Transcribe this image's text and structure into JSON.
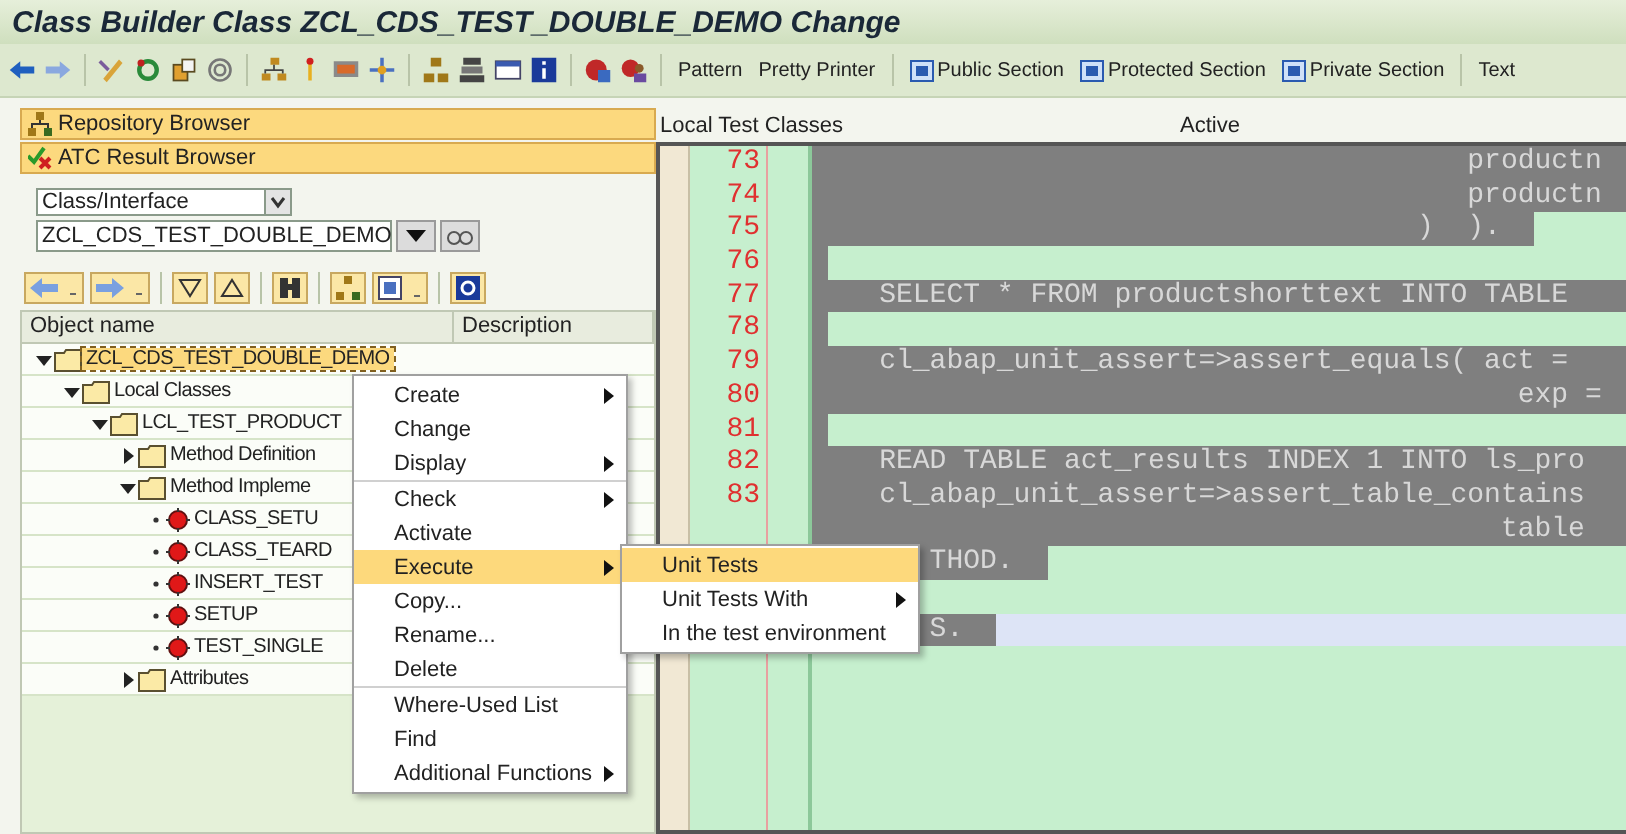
{
  "window": {
    "title": "Class Builder Class ZCL_CDS_TEST_DOUBLE_DEMO Change"
  },
  "toolbar": {
    "buttons": [
      {
        "label": "Pattern",
        "kind": "text"
      },
      {
        "label": "Pretty Printer",
        "kind": "text"
      },
      {
        "label": "Public Section",
        "kind": "section"
      },
      {
        "label": "Protected Section",
        "kind": "section"
      },
      {
        "label": "Private Section",
        "kind": "section"
      },
      {
        "label": "Text",
        "kind": "text"
      }
    ]
  },
  "navigator": {
    "buttons": [
      "Repository Browser",
      "ATC Result Browser"
    ],
    "object_type": "Class/Interface",
    "object_name": "ZCL_CDS_TEST_DOUBLE_DEMO",
    "columns": [
      "Object name",
      "Description"
    ],
    "tree": [
      {
        "label": "ZCL_CDS_TEST_DOUBLE_DEMO",
        "kind": "folder",
        "expanded": true,
        "selected": true,
        "children": [
          {
            "label": "Local Classes",
            "kind": "folder",
            "expanded": true,
            "selected": false,
            "children": [
              {
                "label": "LCL_TEST_PRODUCT",
                "kind": "folder",
                "expanded": true,
                "selected": false,
                "children": [
                  {
                    "label": "Method Definition",
                    "kind": "folder",
                    "expanded": false,
                    "selected": false
                  },
                  {
                    "label": "Method Impleme",
                    "kind": "folder",
                    "expanded": true,
                    "selected": false,
                    "children": [
                      {
                        "label": "CLASS_SETU",
                        "kind": "method",
                        "selected": false
                      },
                      {
                        "label": "CLASS_TEARD",
                        "kind": "method",
                        "selected": false
                      },
                      {
                        "label": "INSERT_TEST",
                        "kind": "method",
                        "selected": false
                      },
                      {
                        "label": "SETUP",
                        "kind": "method",
                        "selected": false
                      },
                      {
                        "label": "TEST_SINGLE",
                        "kind": "method",
                        "selected": false
                      }
                    ]
                  },
                  {
                    "label": "Attributes",
                    "kind": "folder",
                    "expanded": false,
                    "selected": false
                  }
                ]
              }
            ]
          }
        ]
      }
    ]
  },
  "editor": {
    "title": "Local Test Classes",
    "status": "Active",
    "lines": [
      {
        "number": "73",
        "text": "productn",
        "kind": "full"
      },
      {
        "number": "74",
        "text": "productn",
        "kind": "full"
      },
      {
        "number": "75",
        "text": ")  ).",
        "kind": "tail"
      },
      {
        "number": "76",
        "kind": "blank"
      },
      {
        "number": "77",
        "text": "SELECT * FROM productshorttext INTO TABLE",
        "kind": "full"
      },
      {
        "number": "78",
        "kind": "blank"
      },
      {
        "number": "79",
        "text": "cl_abap_unit_assert=>assert_equals( act =",
        "kind": "full"
      },
      {
        "number": "80",
        "text": "exp =",
        "kind": "full"
      },
      {
        "number": "81",
        "kind": "blank"
      },
      {
        "number": "82",
        "text": "READ TABLE act_results INDEX 1 INTO ls_pro",
        "kind": "full"
      },
      {
        "number": "83",
        "text": "cl_abap_unit_assert=>assert_table_contains",
        "kind": "full"
      },
      {
        "text": "table",
        "kind": "full"
      },
      {
        "text": "THOD.",
        "kind": "tail"
      },
      {
        "kind": "empty"
      },
      {
        "text": "S.",
        "kind": "cursor"
      }
    ]
  },
  "context_menu": {
    "groups": [
      [
        {
          "label": "Create",
          "submenu": true,
          "selected": false
        },
        {
          "label": "Change",
          "submenu": false,
          "selected": false
        },
        {
          "label": "Display",
          "submenu": true,
          "selected": false
        }
      ],
      [
        {
          "label": "Check",
          "submenu": true,
          "selected": false
        },
        {
          "label": "Activate",
          "submenu": false,
          "selected": false
        },
        {
          "label": "Execute",
          "submenu": true,
          "selected": true
        },
        {
          "label": "Copy...",
          "submenu": false,
          "selected": false
        },
        {
          "label": "Rename...",
          "submenu": false,
          "selected": false
        },
        {
          "label": "Delete",
          "submenu": false,
          "selected": false
        }
      ],
      [
        {
          "label": "Where-Used List",
          "submenu": false,
          "selected": false
        },
        {
          "label": "Find",
          "submenu": false,
          "selected": false
        },
        {
          "label": "Additional Functions",
          "submenu": true,
          "selected": false
        }
      ]
    ]
  },
  "submenu": {
    "items": [
      {
        "label": "Unit Tests",
        "submenu": false,
        "selected": true
      },
      {
        "label": "Unit Tests With",
        "submenu": true,
        "selected": false
      },
      {
        "label": "In the test environment",
        "submenu": false,
        "selected": false
      }
    ]
  }
}
